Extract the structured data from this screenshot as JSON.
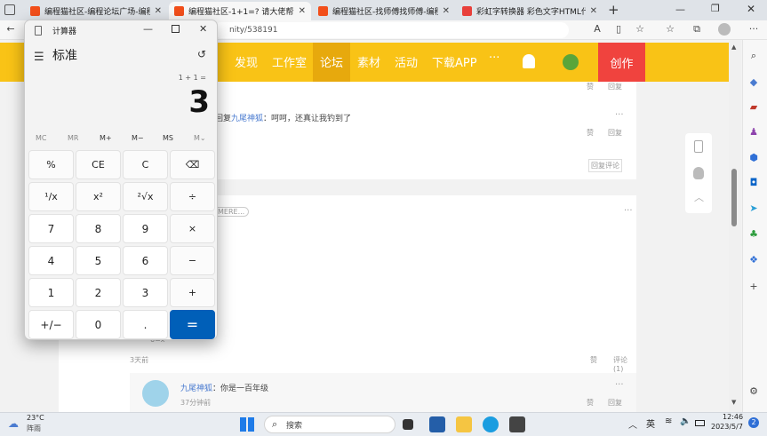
{
  "tabs": [
    {
      "title": "编程猫社区-编程论坛广场-编程学",
      "active": false,
      "favicon_color": "#f24f1b"
    },
    {
      "title": "编程猫社区-1+1=? 请大佬帮帮我",
      "active": true,
      "favicon_color": "#f24f1b"
    },
    {
      "title": "编程猫社区-找师傅找师傅-编程学",
      "active": false,
      "favicon_color": "#f24f1b"
    },
    {
      "title": "彩虹字转换器 彩色文字HTML代码",
      "active": false,
      "favicon_color": "#e8403b"
    }
  ],
  "new_tab": "+",
  "address": {
    "url_visible": "nity/538191"
  },
  "site": {
    "nav": [
      "发现",
      "工作室",
      "论坛",
      "素材",
      "活动",
      "下载APP"
    ],
    "active_nav": "论坛",
    "more": "···",
    "create_button": "创作"
  },
  "posts": {
    "top_like": "赞",
    "top_reply": "回复",
    "reply1": {
      "prefix": "回复",
      "user": "九尾神狐",
      "text": "：呵呵，还真让我钓到了",
      "like": "赞",
      "reply": "回复",
      "more": "···"
    },
    "reply_comment_btn": "回复评论",
    "more_tag": "MERE...",
    "more2": "···",
    "fraction": "6=x",
    "time": "3天前",
    "like": "赞",
    "comments": "评论(1)",
    "subreply": {
      "user": "九尾神狐",
      "text": "：你是一百年级",
      "time": "37分钟前",
      "like": "赞",
      "reply": "回复",
      "more": "···"
    }
  },
  "calculator": {
    "title": "计算器",
    "mode": "标准",
    "expression": "1 + 1 =",
    "result": "3",
    "memory": [
      "MC",
      "MR",
      "M+",
      "M−",
      "MS",
      "M⌄"
    ],
    "keys": [
      [
        "%",
        "CE",
        "C",
        "⌫"
      ],
      [
        "¹/x",
        "x²",
        "²√x",
        "÷"
      ],
      [
        "7",
        "8",
        "9",
        "×"
      ],
      [
        "4",
        "5",
        "6",
        "−"
      ],
      [
        "1",
        "2",
        "3",
        "+"
      ],
      [
        "+/−",
        "0",
        ".",
        "="
      ]
    ]
  },
  "taskbar": {
    "weather_temp": "23°C",
    "weather_desc": "阵雨",
    "search": "搜索",
    "ime": "英",
    "time": "12:46",
    "date": "2023/5/7",
    "notif_count": "2"
  }
}
